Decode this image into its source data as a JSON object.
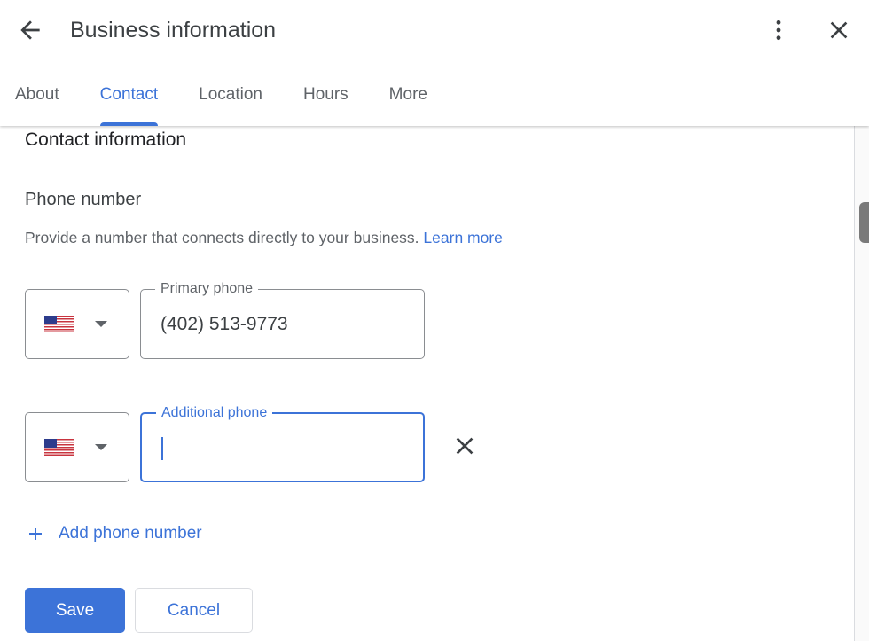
{
  "header": {
    "title": "Business information",
    "back_icon": "arrow-back-icon",
    "more_icon": "more-vert-icon",
    "close_icon": "close-icon"
  },
  "tabs": [
    {
      "label": "About",
      "active": false
    },
    {
      "label": "Contact",
      "active": true
    },
    {
      "label": "Location",
      "active": false
    },
    {
      "label": "Hours",
      "active": false
    },
    {
      "label": "More",
      "active": false
    }
  ],
  "content": {
    "section_title": "Contact information",
    "field_title": "Phone number",
    "helper_text": "Provide a number that connects directly to your business.",
    "learn_more": "Learn more",
    "phones": [
      {
        "label": "Primary phone",
        "value": "(402) 513-9773",
        "country_flag": "us-flag-icon",
        "focused": false
      },
      {
        "label": "Additional phone",
        "value": "",
        "country_flag": "us-flag-icon",
        "focused": true
      }
    ],
    "add_phone_label": "Add phone number"
  },
  "actions": {
    "save_label": "Save",
    "cancel_label": "Cancel"
  },
  "colors": {
    "accent": "#3c73d8",
    "text_primary": "#202124",
    "text_secondary": "#5f6368"
  }
}
